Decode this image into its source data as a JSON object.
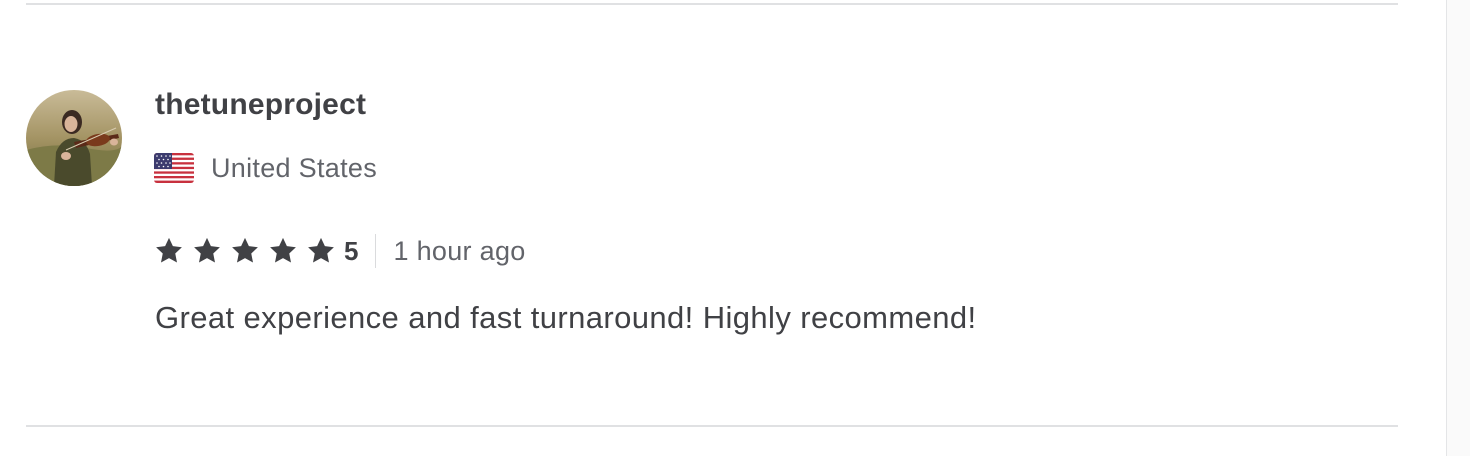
{
  "review": {
    "username": "thetuneproject",
    "country": "United States",
    "flag_icon": "us-flag-icon",
    "rating": "5",
    "stars": 5,
    "time_ago": "1 hour ago",
    "text": "Great experience and fast turnaround! Highly recommend!"
  },
  "colors": {
    "primary_text": "#404145",
    "secondary_text": "#62646a",
    "star": "#404145",
    "divider": "#e0e1e3"
  }
}
